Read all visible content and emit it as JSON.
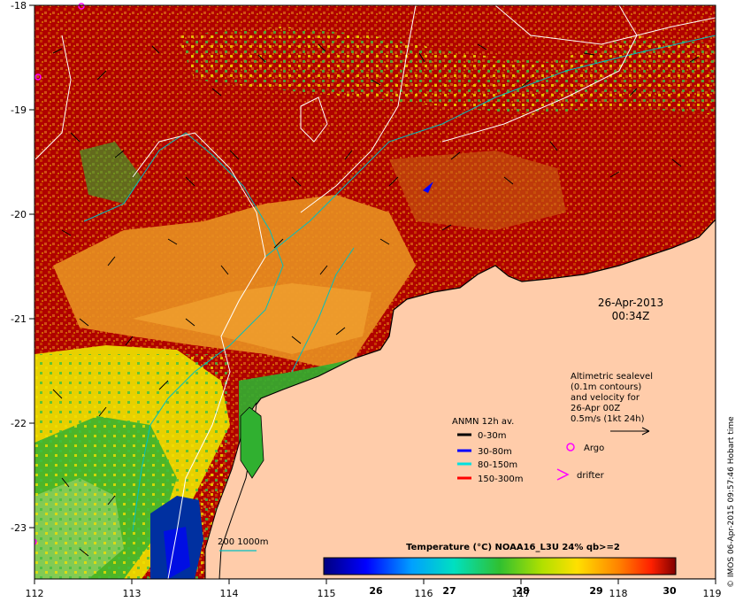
{
  "map": {
    "lon_ticks": [
      "112",
      "113",
      "114",
      "115",
      "116",
      "117",
      "118",
      "119"
    ],
    "lat_ticks": [
      "-18",
      "-19",
      "-20",
      "-21",
      "-22",
      "-23"
    ],
    "date": "26-Apr-2013",
    "time": "00:34Z",
    "altimetry_lines": [
      "Altimetric sealevel",
      "(0.1m contours)",
      "and velocity for",
      "26-Apr 00Z",
      "0.5m/s (1kt 24h)"
    ],
    "anmn_title": "ANMN 12h av.",
    "depth_legend": [
      {
        "label": "0-30m",
        "color": "#000000"
      },
      {
        "label": "30-80m",
        "color": "#0000ff"
      },
      {
        "label": "80-150m",
        "color": "#00e0e0"
      },
      {
        "label": "150-300m",
        "color": "#ff0000"
      }
    ],
    "argo_label": "Argo",
    "drifter_label": "drifter",
    "isobath_label": "200  1000m",
    "colorbar_title": "Temperature (°C) NOAA16_L3U 24% qb>=2",
    "colorbar_ticks": [
      "26",
      "27",
      "28",
      "29",
      "30"
    ],
    "credit": "© IMOS 06-Apr-2015 09:57:46 Hobart time",
    "colors": {
      "land": "#ffccaa",
      "sst_hot": "#a00000",
      "sst_warm": "#e89020",
      "sst_mid": "#e8d000",
      "sst_cool": "#30b030",
      "sst_cold": "#0030a0",
      "argo": "#ff00ff",
      "isobath": "#00c0c0"
    }
  }
}
